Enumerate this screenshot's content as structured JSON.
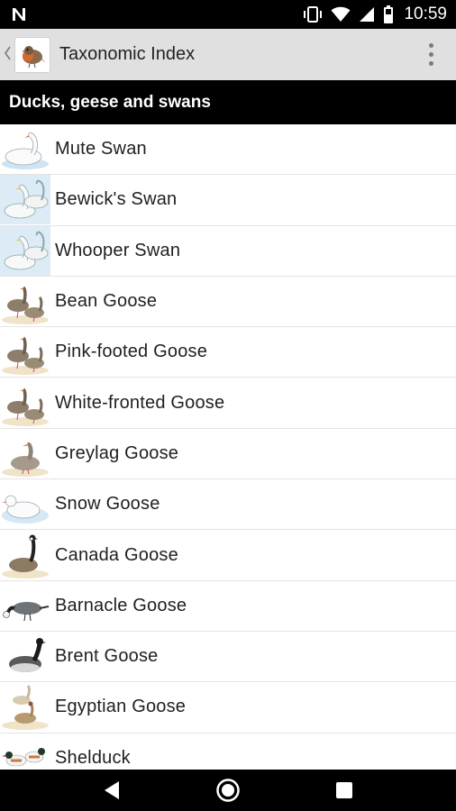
{
  "status_bar": {
    "time": "10:59",
    "icons": [
      "notification-n-icon",
      "vibrate-icon",
      "wifi-icon",
      "cell-signal-icon",
      "battery-icon"
    ]
  },
  "action_bar": {
    "title": "Taxonomic Index",
    "icons": [
      "up-chevron-icon",
      "app-bird-icon",
      "overflow-menu-icon"
    ]
  },
  "section": {
    "title": "Ducks, geese and swans"
  },
  "species": [
    {
      "name": "Mute Swan",
      "thumb": "swan"
    },
    {
      "name": "Bewick's Swan",
      "thumb": "swan-pair"
    },
    {
      "name": "Whooper Swan",
      "thumb": "swan-pair"
    },
    {
      "name": "Bean Goose",
      "thumb": "goose-brown"
    },
    {
      "name": "Pink-footed Goose",
      "thumb": "goose-brown"
    },
    {
      "name": "White-fronted Goose",
      "thumb": "goose-brown"
    },
    {
      "name": "Greylag Goose",
      "thumb": "goose-grey"
    },
    {
      "name": "Snow Goose",
      "thumb": "goose-white"
    },
    {
      "name": "Canada Goose",
      "thumb": "goose-canada"
    },
    {
      "name": "Barnacle Goose",
      "thumb": "goose-barnacle"
    },
    {
      "name": "Brent Goose",
      "thumb": "goose-brent"
    },
    {
      "name": "Egyptian Goose",
      "thumb": "goose-egyptian"
    },
    {
      "name": "Shelduck",
      "thumb": "shelduck"
    }
  ],
  "nav_bar": {
    "icons": [
      "back-triangle-icon",
      "home-circle-icon",
      "recents-square-icon"
    ]
  },
  "colors": {
    "status_bar": "#000000",
    "action_bar": "#e0e0e0",
    "section_header": "#000000",
    "list_background": "#ffffff",
    "divider": "#e4e4e4"
  }
}
